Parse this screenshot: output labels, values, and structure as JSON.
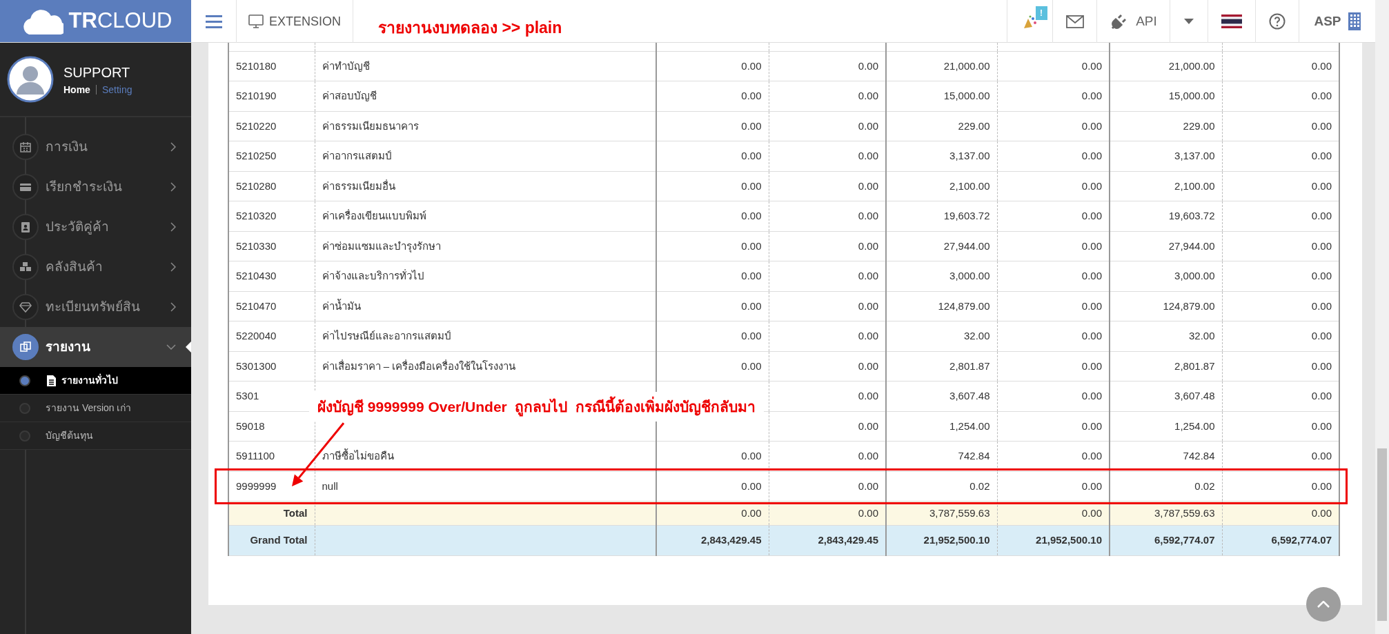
{
  "topbar": {
    "brand": "**TR**CLOUD",
    "extension": "EXTENSION",
    "annotation": "รายงานงบทดลอง >> plain",
    "notification_badge": "!",
    "api": "API",
    "user": "ASP"
  },
  "sidebar": {
    "user_name": "SUPPORT",
    "links": [
      {
        "label": "Home",
        "selected": true
      },
      {
        "label": "Setting",
        "selected": false
      }
    ],
    "menu": [
      {
        "label": "การเงิน",
        "selected": false,
        "expanded": false
      },
      {
        "label": "เรียกชำระเงิน",
        "selected": false,
        "expanded": false
      },
      {
        "label": "ประวัติคู่ค้า",
        "selected": false,
        "expanded": false
      },
      {
        "label": "คลังสินค้า",
        "selected": false,
        "expanded": false
      },
      {
        "label": "ทะเบียนทรัพย์สิน",
        "selected": false,
        "expanded": false
      },
      {
        "label": "รายงาน",
        "selected": true,
        "expanded": true,
        "children": [
          {
            "label": "รายงานทั่วไป",
            "selected": true
          },
          {
            "label": "รายงาน Version เก่า",
            "selected": false
          },
          {
            "label": "บัญชีต้นทุน",
            "selected": false
          }
        ]
      }
    ]
  },
  "table": {
    "rows": [
      {
        "code": "5210180",
        "name": "ค่าทำบัญชี",
        "values": [
          "0.00",
          "0.00",
          "21,000.00",
          "0.00",
          "21,000.00",
          "0.00"
        ],
        "flagged": false
      },
      {
        "code": "5210190",
        "name": "ค่าสอบบัญชี",
        "values": [
          "0.00",
          "0.00",
          "15,000.00",
          "0.00",
          "15,000.00",
          "0.00"
        ],
        "flagged": false
      },
      {
        "code": "5210220",
        "name": "ค่าธรรมเนียมธนาคาร",
        "values": [
          "0.00",
          "0.00",
          "229.00",
          "0.00",
          "229.00",
          "0.00"
        ],
        "flagged": false
      },
      {
        "code": "5210250",
        "name": "ค่าอากรแสตมป์",
        "values": [
          "0.00",
          "0.00",
          "3,137.00",
          "0.00",
          "3,137.00",
          "0.00"
        ],
        "flagged": false
      },
      {
        "code": "5210280",
        "name": "ค่าธรรมเนียมอื่น",
        "values": [
          "0.00",
          "0.00",
          "2,100.00",
          "0.00",
          "2,100.00",
          "0.00"
        ],
        "flagged": false
      },
      {
        "code": "5210320",
        "name": "ค่าเครื่องเขียนแบบพิมพ์",
        "values": [
          "0.00",
          "0.00",
          "19,603.72",
          "0.00",
          "19,603.72",
          "0.00"
        ],
        "flagged": false
      },
      {
        "code": "5210330",
        "name": "ค่าซ่อมแซมและบำรุงรักษา",
        "values": [
          "0.00",
          "0.00",
          "27,944.00",
          "0.00",
          "27,944.00",
          "0.00"
        ],
        "flagged": false
      },
      {
        "code": "5210430",
        "name": "ค่าจ้างและบริการทั่วไป",
        "values": [
          "0.00",
          "0.00",
          "3,000.00",
          "0.00",
          "3,000.00",
          "0.00"
        ],
        "flagged": false
      },
      {
        "code": "5210470",
        "name": "ค่าน้ำมัน",
        "values": [
          "0.00",
          "0.00",
          "124,879.00",
          "0.00",
          "124,879.00",
          "0.00"
        ],
        "flagged": false
      },
      {
        "code": "5220040",
        "name": "ค่าไปรษณีย์และอากรแสตมป์",
        "values": [
          "0.00",
          "0.00",
          "32.00",
          "0.00",
          "32.00",
          "0.00"
        ],
        "flagged": false
      },
      {
        "code": "5301300",
        "name": "ค่าเสื่อมราคา – เครื่องมือเครื่องใช้ในโรงงาน",
        "values": [
          "0.00",
          "0.00",
          "2,801.87",
          "0.00",
          "2,801.87",
          "0.00"
        ],
        "flagged": false
      },
      {
        "code": "5301",
        "values": [
          "0.00",
          "3,607.48",
          "0.00",
          "3,607.48",
          "0.00"
        ],
        "flagged": false
      },
      {
        "code": "59018",
        "values": [
          "0.00",
          "1,254.00",
          "0.00",
          "1,254.00",
          "0.00"
        ],
        "flagged": false
      },
      {
        "code": "5911100",
        "name": "ภาษีซื้อไม่ขอคืน",
        "values": [
          "0.00",
          "0.00",
          "742.84",
          "0.00",
          "742.84",
          "0.00"
        ],
        "flagged": false
      },
      {
        "code": "9999999",
        "name": "null",
        "values": [
          "0.00",
          "0.00",
          "0.02",
          "0.00",
          "0.02",
          "0.00"
        ],
        "flagged": true
      }
    ],
    "total": {
      "label": "Total",
      "values": [
        "0.00",
        "0.00",
        "3,787,559.63",
        "0.00",
        "3,787,559.63",
        "0.00"
      ]
    },
    "grand_total": {
      "label": "Grand Total",
      "values": [
        "2,843,429.45",
        "2,843,429.45",
        "21,952,500.10",
        "21,952,500.10",
        "6,592,774.07",
        "6,592,774.07"
      ]
    }
  },
  "annotation": {
    "text": "ผังบัญชี 9999999 Over/Under  ถูกลบไป  กรณีนี้ต้องเพิ่มผังบัญชีกลับมา"
  }
}
